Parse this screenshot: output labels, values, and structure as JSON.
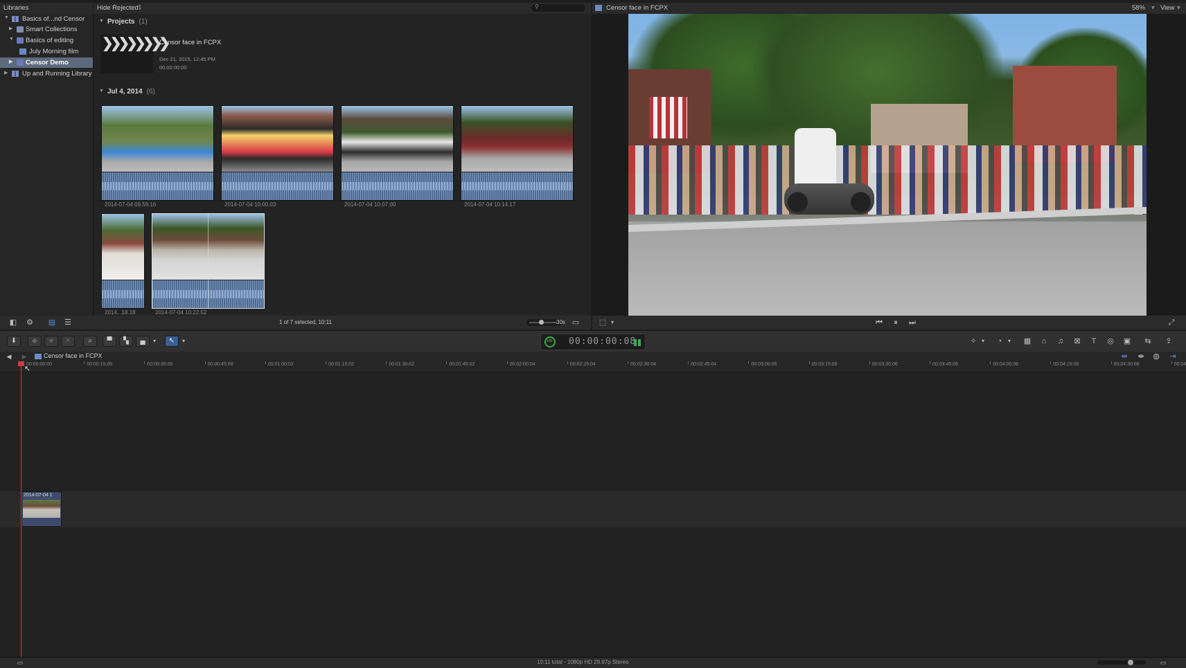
{
  "libraries_header": {
    "title": "Libraries"
  },
  "browser_header": {
    "filter": "Hide Rejected",
    "filter_arrow": "⇕"
  },
  "viewer_header": {
    "title": "Censor face in FCPX",
    "zoom": "58%",
    "view": "View"
  },
  "sidebar": {
    "items": [
      {
        "label": "Basics of...nd Censor",
        "icon": "library-icon"
      },
      {
        "label": "Smart Collections",
        "icon": "folder-icon"
      },
      {
        "label": "Basics of editing",
        "icon": "event-icon"
      },
      {
        "label": "July  Morning film",
        "icon": "project-icon"
      },
      {
        "label": "Censor Demo",
        "icon": "event-icon",
        "selected": true
      },
      {
        "label": "Up and Running Library",
        "icon": "library-icon"
      }
    ]
  },
  "browser": {
    "projects_title": "Projects",
    "projects_count": "(1)",
    "project": {
      "name": "Censor face in FCPX",
      "date": "Dec 21, 2015, 12:45 PM",
      "duration": "00:00:00:00"
    },
    "event_title": "Jul 4, 2014",
    "event_count": "(6)",
    "clips": [
      {
        "label": "2014-07-04 09.59.16"
      },
      {
        "label": "2014-07-04 10.00.03"
      },
      {
        "label": "2014-07-04 10.07.00"
      },
      {
        "label": "2014-07-04 10.14.17"
      },
      {
        "label": "2014...18.18"
      },
      {
        "label": "2014-07-04 10.22.52"
      }
    ],
    "selection_status": "1 of 7 selected, 10:11",
    "clip_duration": "30s"
  },
  "timeline": {
    "project_name": "Censor face in FCPX",
    "ruler": [
      "00:00:00:00",
      "00:00:15:00",
      "00:00:30:00",
      "00:00:45:00",
      "00:01:00:02",
      "00:01:15:02",
      "00:01:30:02",
      "00:01:45:02",
      "00:02:00:04",
      "00:02:15:04",
      "00:02:30:04",
      "00:02:45:04",
      "00:03:00:06",
      "00:03:15:06",
      "00:03:30:06",
      "00:03:45:06",
      "00:04:00:06",
      "00:04:15:06",
      "00:04:30:08",
      "00:04"
    ],
    "clip_label": "2014-07-04 1",
    "timecode": "00:00:00:08",
    "timecode_meter": "100"
  },
  "footer": {
    "status": "10:11 total - 1080p HD 29.97p Stereo"
  },
  "colors": {
    "accent": "#3a5f95",
    "selection": "#5d6a7d",
    "playhead": "#d23a3a"
  }
}
